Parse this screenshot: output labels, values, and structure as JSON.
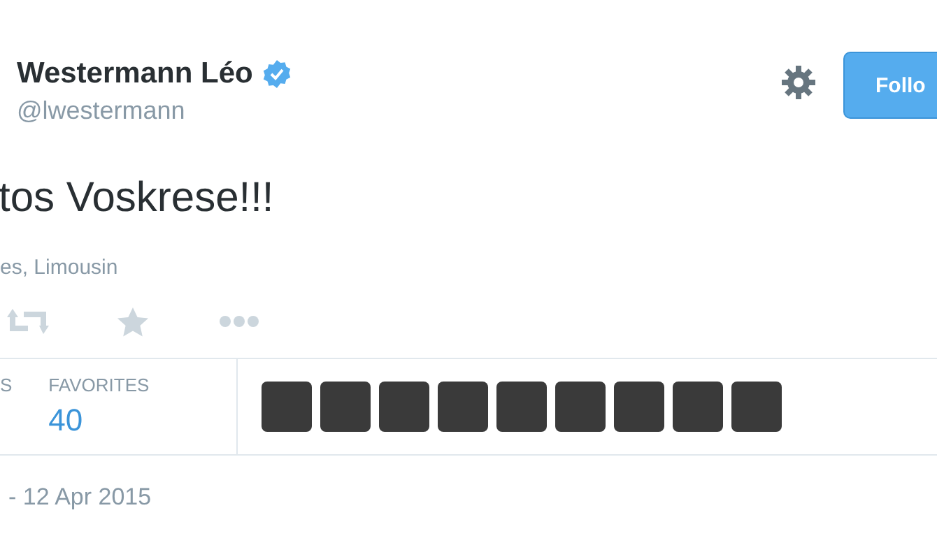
{
  "author": {
    "name": "Westermann Léo",
    "verified": true,
    "handle": "@lwestermann"
  },
  "follow_button": {
    "label": "Follo"
  },
  "tweet": {
    "text": "tos Voskrese!!!",
    "location": "es, Limousin"
  },
  "actions": [
    {
      "kind": "retweet"
    },
    {
      "kind": "favorite"
    },
    {
      "kind": "more"
    }
  ],
  "stats": [
    {
      "label": "S"
    },
    {
      "label": "FAVORITES",
      "value": "40"
    }
  ],
  "favoriters": [
    {
      "kind": "photo"
    },
    {
      "kind": "photo"
    },
    {
      "kind": "photo"
    },
    {
      "kind": "photo"
    },
    {
      "kind": "photo"
    },
    {
      "kind": "photo"
    },
    {
      "kind": "photo"
    },
    {
      "kind": "photo"
    },
    {
      "kind": "photo"
    }
  ],
  "date": "- 12 Apr 2015"
}
